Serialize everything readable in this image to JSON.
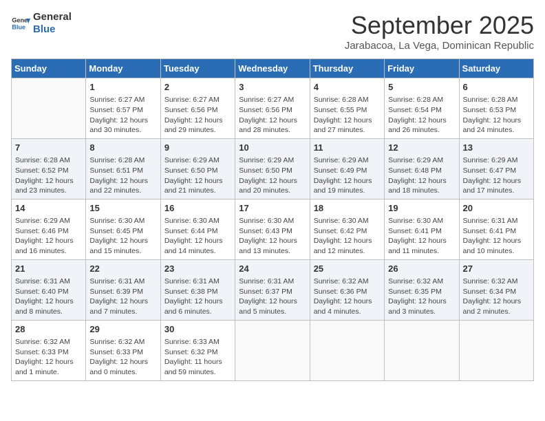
{
  "logo": {
    "line1": "General",
    "line2": "Blue"
  },
  "title": "September 2025",
  "subtitle": "Jarabacoa, La Vega, Dominican Republic",
  "days_header": [
    "Sunday",
    "Monday",
    "Tuesday",
    "Wednesday",
    "Thursday",
    "Friday",
    "Saturday"
  ],
  "weeks": [
    [
      {
        "day": "",
        "info": ""
      },
      {
        "day": "1",
        "info": "Sunrise: 6:27 AM\nSunset: 6:57 PM\nDaylight: 12 hours\nand 30 minutes."
      },
      {
        "day": "2",
        "info": "Sunrise: 6:27 AM\nSunset: 6:56 PM\nDaylight: 12 hours\nand 29 minutes."
      },
      {
        "day": "3",
        "info": "Sunrise: 6:27 AM\nSunset: 6:56 PM\nDaylight: 12 hours\nand 28 minutes."
      },
      {
        "day": "4",
        "info": "Sunrise: 6:28 AM\nSunset: 6:55 PM\nDaylight: 12 hours\nand 27 minutes."
      },
      {
        "day": "5",
        "info": "Sunrise: 6:28 AM\nSunset: 6:54 PM\nDaylight: 12 hours\nand 26 minutes."
      },
      {
        "day": "6",
        "info": "Sunrise: 6:28 AM\nSunset: 6:53 PM\nDaylight: 12 hours\nand 24 minutes."
      }
    ],
    [
      {
        "day": "7",
        "info": "Sunrise: 6:28 AM\nSunset: 6:52 PM\nDaylight: 12 hours\nand 23 minutes."
      },
      {
        "day": "8",
        "info": "Sunrise: 6:28 AM\nSunset: 6:51 PM\nDaylight: 12 hours\nand 22 minutes."
      },
      {
        "day": "9",
        "info": "Sunrise: 6:29 AM\nSunset: 6:50 PM\nDaylight: 12 hours\nand 21 minutes."
      },
      {
        "day": "10",
        "info": "Sunrise: 6:29 AM\nSunset: 6:50 PM\nDaylight: 12 hours\nand 20 minutes."
      },
      {
        "day": "11",
        "info": "Sunrise: 6:29 AM\nSunset: 6:49 PM\nDaylight: 12 hours\nand 19 minutes."
      },
      {
        "day": "12",
        "info": "Sunrise: 6:29 AM\nSunset: 6:48 PM\nDaylight: 12 hours\nand 18 minutes."
      },
      {
        "day": "13",
        "info": "Sunrise: 6:29 AM\nSunset: 6:47 PM\nDaylight: 12 hours\nand 17 minutes."
      }
    ],
    [
      {
        "day": "14",
        "info": "Sunrise: 6:29 AM\nSunset: 6:46 PM\nDaylight: 12 hours\nand 16 minutes."
      },
      {
        "day": "15",
        "info": "Sunrise: 6:30 AM\nSunset: 6:45 PM\nDaylight: 12 hours\nand 15 minutes."
      },
      {
        "day": "16",
        "info": "Sunrise: 6:30 AM\nSunset: 6:44 PM\nDaylight: 12 hours\nand 14 minutes."
      },
      {
        "day": "17",
        "info": "Sunrise: 6:30 AM\nSunset: 6:43 PM\nDaylight: 12 hours\nand 13 minutes."
      },
      {
        "day": "18",
        "info": "Sunrise: 6:30 AM\nSunset: 6:42 PM\nDaylight: 12 hours\nand 12 minutes."
      },
      {
        "day": "19",
        "info": "Sunrise: 6:30 AM\nSunset: 6:41 PM\nDaylight: 12 hours\nand 11 minutes."
      },
      {
        "day": "20",
        "info": "Sunrise: 6:31 AM\nSunset: 6:41 PM\nDaylight: 12 hours\nand 10 minutes."
      }
    ],
    [
      {
        "day": "21",
        "info": "Sunrise: 6:31 AM\nSunset: 6:40 PM\nDaylight: 12 hours\nand 8 minutes."
      },
      {
        "day": "22",
        "info": "Sunrise: 6:31 AM\nSunset: 6:39 PM\nDaylight: 12 hours\nand 7 minutes."
      },
      {
        "day": "23",
        "info": "Sunrise: 6:31 AM\nSunset: 6:38 PM\nDaylight: 12 hours\nand 6 minutes."
      },
      {
        "day": "24",
        "info": "Sunrise: 6:31 AM\nSunset: 6:37 PM\nDaylight: 12 hours\nand 5 minutes."
      },
      {
        "day": "25",
        "info": "Sunrise: 6:32 AM\nSunset: 6:36 PM\nDaylight: 12 hours\nand 4 minutes."
      },
      {
        "day": "26",
        "info": "Sunrise: 6:32 AM\nSunset: 6:35 PM\nDaylight: 12 hours\nand 3 minutes."
      },
      {
        "day": "27",
        "info": "Sunrise: 6:32 AM\nSunset: 6:34 PM\nDaylight: 12 hours\nand 2 minutes."
      }
    ],
    [
      {
        "day": "28",
        "info": "Sunrise: 6:32 AM\nSunset: 6:33 PM\nDaylight: 12 hours\nand 1 minute."
      },
      {
        "day": "29",
        "info": "Sunrise: 6:32 AM\nSunset: 6:33 PM\nDaylight: 12 hours\nand 0 minutes."
      },
      {
        "day": "30",
        "info": "Sunrise: 6:33 AM\nSunset: 6:32 PM\nDaylight: 11 hours\nand 59 minutes."
      },
      {
        "day": "",
        "info": ""
      },
      {
        "day": "",
        "info": ""
      },
      {
        "day": "",
        "info": ""
      },
      {
        "day": "",
        "info": ""
      }
    ]
  ]
}
